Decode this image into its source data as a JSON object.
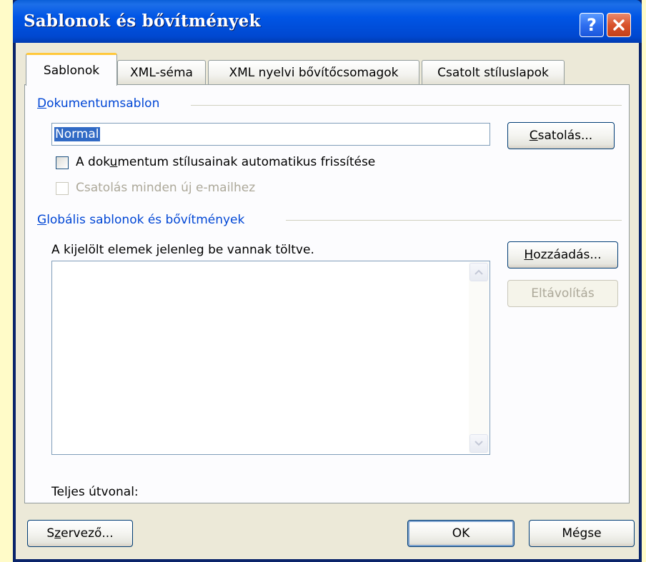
{
  "window": {
    "title": "Sablonok és bővítmények",
    "help_glyph": "?",
    "title_color": "#0055E5"
  },
  "tabs": [
    {
      "label": "Sablonok",
      "active": true
    },
    {
      "label": "XML-séma",
      "active": false
    },
    {
      "label": "XML nyelvi bővítőcsomagok",
      "active": false
    },
    {
      "label": "Csatolt stíluslapok",
      "active": false
    }
  ],
  "document_template": {
    "group_label_first": "D",
    "group_label_rest": "okumentumsablon",
    "template_value": "Normal",
    "attach_button": {
      "first": "C",
      "rest": "satolás..."
    },
    "auto_update_checkbox": {
      "before": "A dok",
      "mnemonic": "u",
      "after": "mentum stílusainak automatikus frissítése",
      "checked": false
    },
    "attach_to_email_checkbox": {
      "label": "Csatolás minden új e-mailhez",
      "checked": false,
      "disabled": true
    }
  },
  "global_templates": {
    "group_label_first": "G",
    "group_label_rest": "lobális sablonok és bővítmények",
    "description": "A kijelölt elemek jelenleg be vannak töltve.",
    "add_button": {
      "first": "H",
      "rest": "ozzáadás..."
    },
    "remove_button": {
      "label": "Eltávolítás",
      "disabled": true
    },
    "items": []
  },
  "full_path_label": "Teljes útvonal:",
  "footer": {
    "organizer_button": {
      "before": "S",
      "mnemonic": "z",
      "after": "ervező..."
    },
    "ok_label": "OK",
    "cancel_label": "Mégse"
  }
}
